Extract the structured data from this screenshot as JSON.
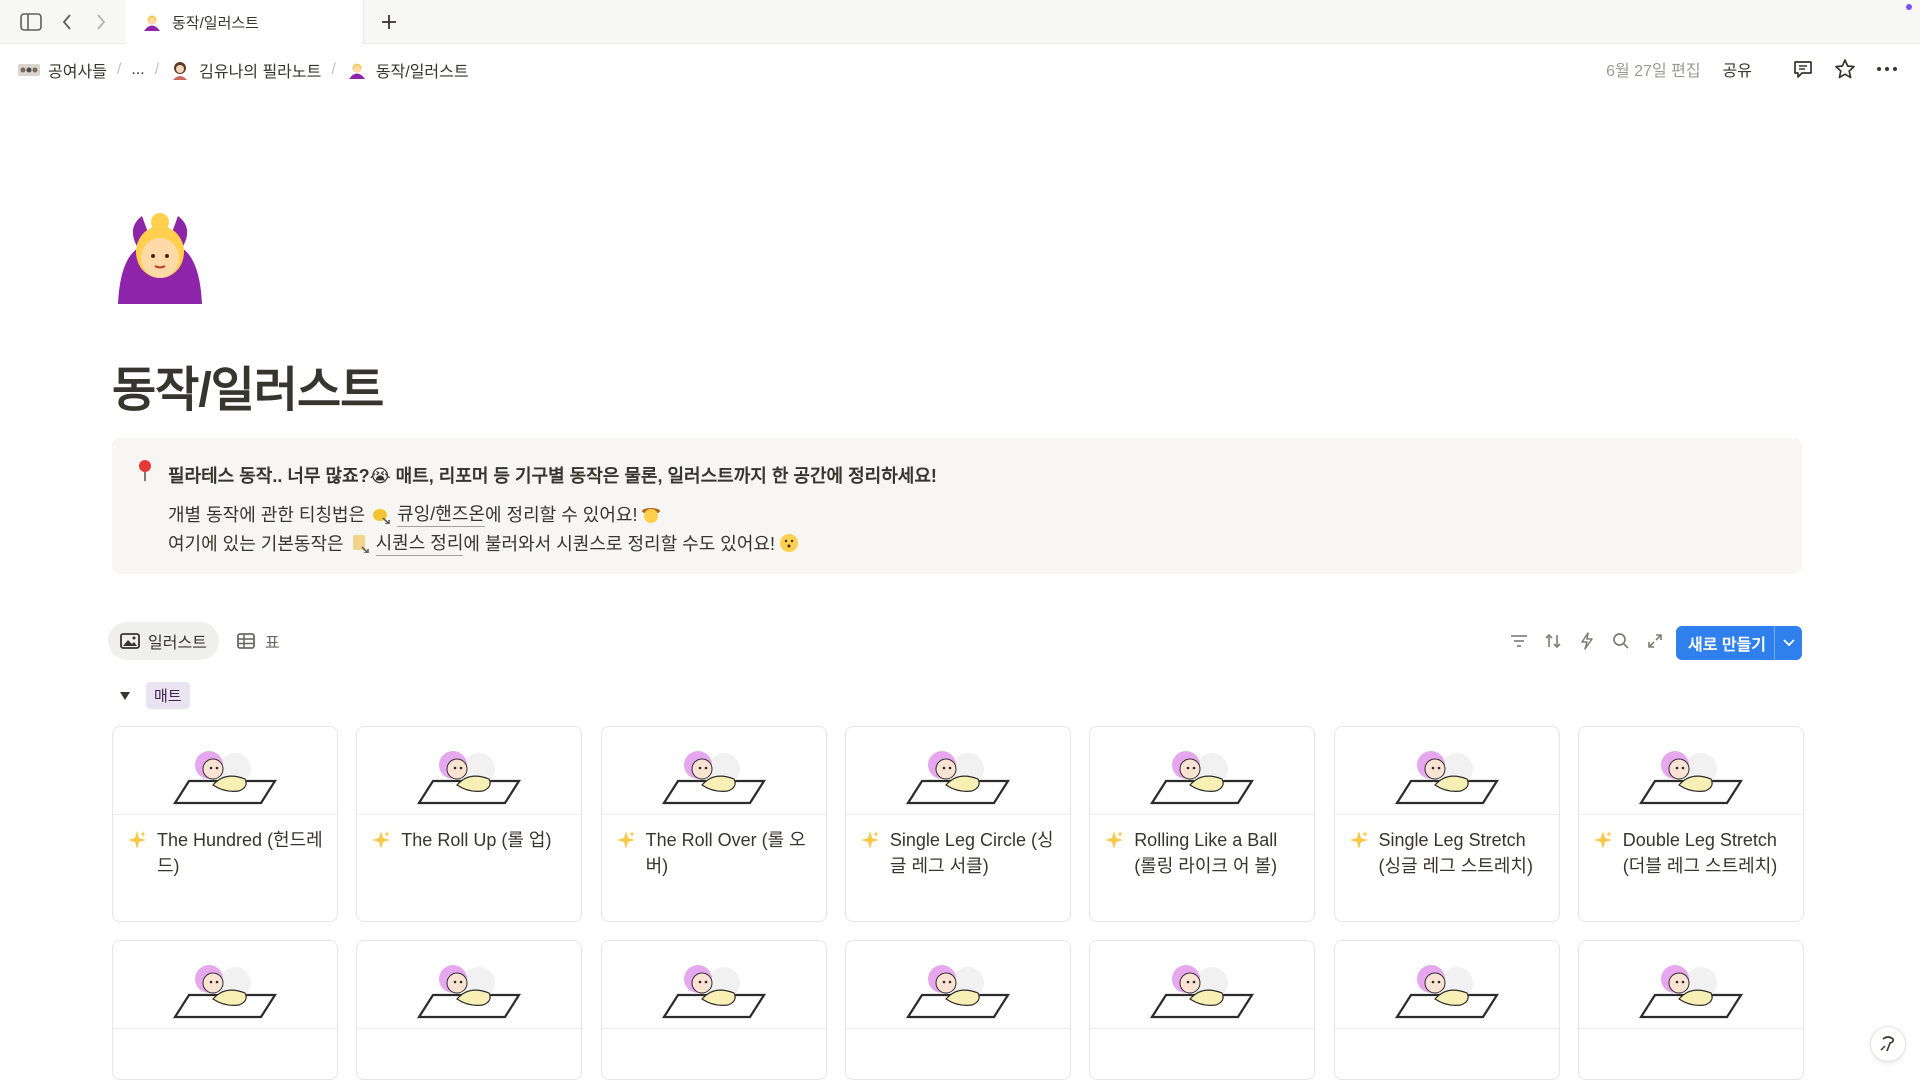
{
  "tabbar": {
    "tab_title": "동작/일러스트"
  },
  "breadcrumb": {
    "items": [
      "공여사들",
      "...",
      "김유나의 필라노트",
      "동작/일러스트"
    ]
  },
  "topright": {
    "edited": "6월 27일 편집",
    "share": "공유"
  },
  "page": {
    "title": "동작/일러스트"
  },
  "callout": {
    "line1": "필라테스 동작.. 너무 많죠?😭 매트, 리포머 등 기구별 동작은 물론, 일러스트까지 한 공간에 정리하세요!",
    "line2_pre": "개별 동작에 관한 티칭법은",
    "line2_link": "큐잉/핸즈온",
    "line2_post": "에 정리할 수 있어요!",
    "line3_pre": "여기에 있는 기본동작은",
    "line3_link": "시퀀스 정리",
    "line3_post": "에 불러와서 시퀀스로 정리할 수도 있어요!"
  },
  "views": [
    {
      "label": "일러스트",
      "icon": "image-icon",
      "active": true
    },
    {
      "label": "표",
      "icon": "table-icon",
      "active": false
    }
  ],
  "toolbar": {
    "new_label": "새로 만들기"
  },
  "group": {
    "label": "매트"
  },
  "cards_row1": [
    {
      "title": "The Hundred (헌드레드)"
    },
    {
      "title": "The Roll Up (롤 업)"
    },
    {
      "title": "The Roll Over (롤 오버)"
    },
    {
      "title": "Single Leg Circle (싱글 레그 서클)"
    },
    {
      "title": "Rolling Like a Ball (롤링 라이크 어 볼)"
    },
    {
      "title": "Single Leg Stretch (싱글 레그 스트레치)"
    },
    {
      "title": "Double Leg Stretch (더블 레그 스트레치)"
    }
  ],
  "colors": {
    "accent": "#2f80ed",
    "tag_bg": "#eae4f2",
    "callout_bg": "#f7f6f3"
  }
}
